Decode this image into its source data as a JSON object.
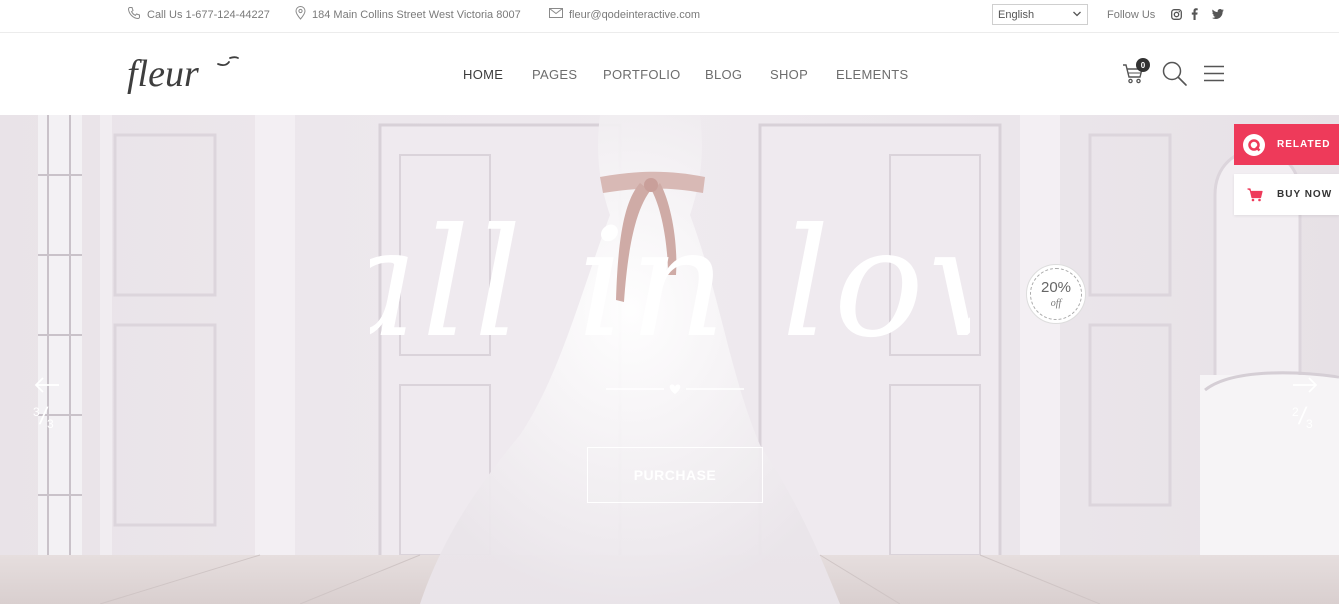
{
  "topbar": {
    "phone": "Call Us 1-677-124-44227",
    "address": "184 Main Collins Street West Victoria 8007",
    "email": "fleur@qodeinteractive.com",
    "language": "English",
    "follow_label": "Follow Us",
    "social_icons": [
      "instagram-icon",
      "facebook-icon",
      "twitter-icon"
    ]
  },
  "header": {
    "logo_text": "fleur",
    "nav": [
      "HOME",
      "PAGES",
      "PORTFOLIO",
      "BLOG",
      "SHOP",
      "ELEMENTS"
    ],
    "active_nav": "HOME",
    "cart_count": "0"
  },
  "hero": {
    "headline": "Fall in love",
    "button_label": "PURCHASE",
    "badge_percent": "20%",
    "badge_off": "off",
    "prev_counter": [
      "3",
      "3"
    ],
    "next_counter": [
      "2",
      "3"
    ]
  },
  "widgets": {
    "related": "RELATED",
    "buy_now": "BUY NOW"
  },
  "colors": {
    "accent": "#ee3a5a",
    "text": "#555555"
  }
}
